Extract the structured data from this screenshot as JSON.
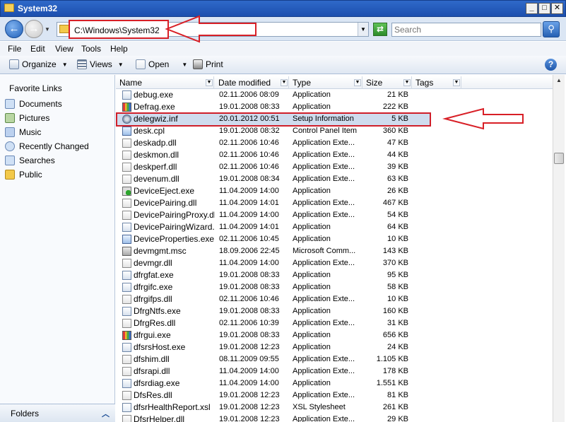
{
  "window": {
    "title": "System32"
  },
  "address": {
    "path": "C:\\Windows\\System32",
    "search_placeholder": "Search"
  },
  "menu": [
    "File",
    "Edit",
    "View",
    "Tools",
    "Help"
  ],
  "toolbar": {
    "organize": "Organize",
    "views": "Views",
    "open": "Open",
    "print": "Print"
  },
  "nav": {
    "heading": "Favorite Links",
    "items": [
      "Documents",
      "Pictures",
      "Music",
      "Recently Changed",
      "Searches",
      "Public"
    ],
    "folders_label": "Folders"
  },
  "columns": {
    "name": "Name",
    "date": "Date modified",
    "type": "Type",
    "size": "Size",
    "tags": "Tags"
  },
  "files": [
    {
      "name": "debug.exe",
      "date": "02.11.2006 08:09",
      "type": "Application",
      "size": "21 KB",
      "icon": "exe-icon"
    },
    {
      "name": "Defrag.exe",
      "date": "19.01.2008 08:33",
      "type": "Application",
      "size": "222 KB",
      "icon": "defrag-icon"
    },
    {
      "name": "delegwiz.inf",
      "date": "20.01.2012 00:51",
      "type": "Setup Information",
      "size": "5 KB",
      "icon": "setup-info-icon"
    },
    {
      "name": "desk.cpl",
      "date": "19.01.2008 08:32",
      "type": "Control Panel Item",
      "size": "360 KB",
      "icon": "control-panel-icon"
    },
    {
      "name": "deskadp.dll",
      "date": "02.11.2006 10:46",
      "type": "Application Exte...",
      "size": "47 KB",
      "icon": "dll-icon"
    },
    {
      "name": "deskmon.dll",
      "date": "02.11.2006 10:46",
      "type": "Application Exte...",
      "size": "44 KB",
      "icon": "dll-icon"
    },
    {
      "name": "deskperf.dll",
      "date": "02.11.2006 10:46",
      "type": "Application Exte...",
      "size": "39 KB",
      "icon": "dll-icon"
    },
    {
      "name": "devenum.dll",
      "date": "19.01.2008 08:34",
      "type": "Application Exte...",
      "size": "63 KB",
      "icon": "dll-icon"
    },
    {
      "name": "DeviceEject.exe",
      "date": "11.04.2009 14:00",
      "type": "Application",
      "size": "26 KB",
      "icon": "device-eject-icon"
    },
    {
      "name": "DevicePairing.dll",
      "date": "11.04.2009 14:01",
      "type": "Application Exte...",
      "size": "467 KB",
      "icon": "dll-icon"
    },
    {
      "name": "DevicePairingProxy.dll",
      "date": "11.04.2009 14:00",
      "type": "Application Exte...",
      "size": "54 KB",
      "icon": "dll-icon"
    },
    {
      "name": "DevicePairingWizard...",
      "date": "11.04.2009 14:01",
      "type": "Application",
      "size": "64 KB",
      "icon": "wizard-icon"
    },
    {
      "name": "DeviceProperties.exe",
      "date": "02.11.2006 10:45",
      "type": "Application",
      "size": "10 KB",
      "icon": "device-properties-icon"
    },
    {
      "name": "devmgmt.msc",
      "date": "18.09.2006 22:45",
      "type": "Microsoft Comm...",
      "size": "143 KB",
      "icon": "console-icon"
    },
    {
      "name": "devmgr.dll",
      "date": "11.04.2009 14:00",
      "type": "Application Exte...",
      "size": "370 KB",
      "icon": "dll-icon"
    },
    {
      "name": "dfrgfat.exe",
      "date": "19.01.2008 08:33",
      "type": "Application",
      "size": "95 KB",
      "icon": "exe-icon"
    },
    {
      "name": "dfrgifc.exe",
      "date": "19.01.2008 08:33",
      "type": "Application",
      "size": "58 KB",
      "icon": "exe-icon"
    },
    {
      "name": "dfrgifps.dll",
      "date": "02.11.2006 10:46",
      "type": "Application Exte...",
      "size": "10 KB",
      "icon": "dll-icon"
    },
    {
      "name": "DfrgNtfs.exe",
      "date": "19.01.2008 08:33",
      "type": "Application",
      "size": "160 KB",
      "icon": "exe-icon"
    },
    {
      "name": "DfrgRes.dll",
      "date": "02.11.2006 10:39",
      "type": "Application Exte...",
      "size": "31 KB",
      "icon": "dll-icon"
    },
    {
      "name": "dfrgui.exe",
      "date": "19.01.2008 08:33",
      "type": "Application",
      "size": "656 KB",
      "icon": "defrag-icon"
    },
    {
      "name": "dfsrsHost.exe",
      "date": "19.01.2008 12:23",
      "type": "Application",
      "size": "24 KB",
      "icon": "exe-icon"
    },
    {
      "name": "dfshim.dll",
      "date": "08.11.2009 09:55",
      "type": "Application Exte...",
      "size": "1.105 KB",
      "icon": "dll-icon"
    },
    {
      "name": "dfsrapi.dll",
      "date": "11.04.2009 14:00",
      "type": "Application Exte...",
      "size": "178 KB",
      "icon": "dll-icon"
    },
    {
      "name": "dfsrdiag.exe",
      "date": "11.04.2009 14:00",
      "type": "Application",
      "size": "1.551 KB",
      "icon": "exe-icon"
    },
    {
      "name": "DfsRes.dll",
      "date": "19.01.2008 12:23",
      "type": "Application Exte...",
      "size": "81 KB",
      "icon": "dll-icon"
    },
    {
      "name": "dfsrHealthReport.xsl",
      "date": "19.01.2008 12:23",
      "type": "XSL Stylesheet",
      "size": "261 KB",
      "icon": "xsl-icon"
    },
    {
      "name": "DfsrHelper.dll",
      "date": "19.01.2008 12:23",
      "type": "Application Exte...",
      "size": "29 KB",
      "icon": "dll-icon"
    }
  ],
  "highlight": {
    "row_index": 2,
    "color": "#d81f26",
    "row_bg": "#cfdcee"
  },
  "colors": {
    "titlebar": "#1c4fae",
    "toolbar": "#dfe7f2",
    "annotation": "#d81f26"
  }
}
